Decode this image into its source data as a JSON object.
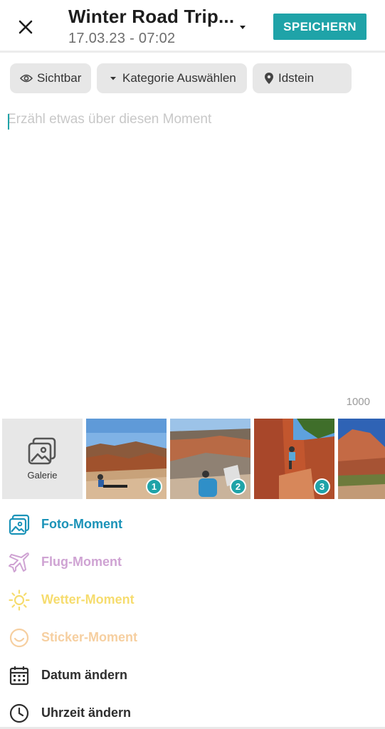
{
  "header": {
    "close_icon": "close-icon",
    "title": "Winter Road Trip...",
    "subtitle": "17.03.23 - 07:02",
    "save_label": "SPEICHERN",
    "accent_color": "#1fa3a8"
  },
  "chips": {
    "visibility": {
      "label": "Sichtbar",
      "icon": "eye-icon"
    },
    "category": {
      "label": "Kategorie Auswählen",
      "icon": "caret-down-icon"
    },
    "location": {
      "label": "Idstein",
      "icon": "location-pin-icon"
    }
  },
  "editor": {
    "placeholder": "Erzähl etwas über diesen Moment",
    "value": "",
    "counter": "1000"
  },
  "gallery": {
    "button_label": "Galerie",
    "button_icon": "gallery-icon",
    "photos": [
      {
        "badge": "1",
        "description": "person sitting on red rock canyon edge"
      },
      {
        "badge": "2",
        "description": "person in blue shirt at canyon overlook"
      },
      {
        "badge": "3",
        "description": "climber between red rock walls"
      },
      {
        "badge": "",
        "description": "red rock formation under blue sky"
      }
    ]
  },
  "menu": [
    {
      "label": "Foto-Moment",
      "icon": "photo-icon",
      "color": "#1b93b8"
    },
    {
      "label": "Flug-Moment",
      "icon": "airplane-icon",
      "color": "#cfa3d3"
    },
    {
      "label": "Wetter-Moment",
      "icon": "sun-icon",
      "color": "#f6dc6e"
    },
    {
      "label": "Sticker-Moment",
      "icon": "smiley-icon",
      "color": "#f6cfa0"
    },
    {
      "label": "Datum ändern",
      "icon": "calendar-icon",
      "color": "#2e2e2e"
    },
    {
      "label": "Uhrzeit ändern",
      "icon": "clock-icon",
      "color": "#2e2e2e"
    }
  ]
}
